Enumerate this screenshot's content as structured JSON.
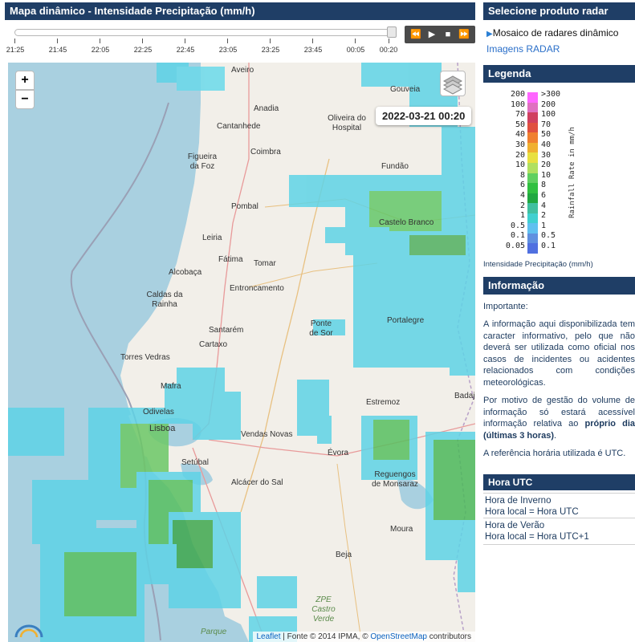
{
  "map_panel": {
    "title": "Mapa dinâmico - Intensidade Precipitação (mm/h)"
  },
  "timeline": {
    "ticks": [
      "21:25",
      "21:45",
      "22:05",
      "22:25",
      "22:45",
      "23:05",
      "23:25",
      "23:45",
      "00:05",
      "00:20"
    ],
    "controls": {
      "rewind": "⏪",
      "play": "▶",
      "stop": "■",
      "forward": "⏩"
    }
  },
  "map": {
    "zoom_in": "+",
    "zoom_out": "−",
    "timestamp": "2022-03-21 00:20",
    "cities": [
      "Aveiro",
      "Gouveia",
      "Anadia",
      "Oliveira do Hospital",
      "Cantanhede",
      "Coimbra",
      "Figueira da Foz",
      "Fundão",
      "Pombal",
      "Castelo Branco",
      "Leiria",
      "Fátima",
      "Tomar",
      "Alcobaça",
      "Caldas da Rainha",
      "Entroncamento",
      "Santarém",
      "Ponte de Sor",
      "Portalegre",
      "Cartaxo",
      "Torres Vedras",
      "Mafra",
      "Odivelas",
      "Lisboa",
      "Setúbal",
      "Vendas Novas",
      "Estremoz",
      "Évora",
      "Reguengos de Monsaraz",
      "Alcácer do Sal",
      "Moura",
      "Beja",
      "ZPE Castro Verde",
      "Badajoz",
      "Parque"
    ],
    "attribution": {
      "leaflet": "Leaflet",
      "fonte": " | Fonte © 2014 IPMA, © ",
      "osm": "OpenStreetMap",
      "contrib": " contributors"
    }
  },
  "radar_product": {
    "title": "Selecione produto radar",
    "options": [
      "Mosaico de radares dinâmico",
      "Imagens RADAR"
    ]
  },
  "legend": {
    "title": "Legenda",
    "left_scale": [
      "200",
      "100",
      "70",
      "50",
      "40",
      "30",
      "20",
      "10",
      "8",
      "6",
      "4",
      "2",
      "1",
      "0.5",
      "0.1",
      "0.05"
    ],
    "right_scale": [
      ">300",
      "200",
      "100",
      "70",
      "50",
      "40",
      "30",
      "20",
      "10",
      "8",
      "6",
      "4",
      "2",
      "1",
      "0.5",
      "0.1"
    ],
    "axis_label": "Rainfall Rate in mm/h",
    "caption": "Intensidade Precipitação  (mm/h)",
    "colors": [
      "#ff66ff",
      "#e070c0",
      "#d04060",
      "#e05040",
      "#f08030",
      "#f0b030",
      "#e8e040",
      "#b0e060",
      "#60d060",
      "#30c040",
      "#20a840",
      "#40c0a0",
      "#40d0d0",
      "#60c0f0",
      "#6090e0",
      "#5070e0"
    ]
  },
  "info": {
    "title": "Informação",
    "important": "Importante:",
    "p1": "A informação aqui disponibilizada tem caracter informativo, pelo que não deverá ser utilizada como oficial nos casos de incidentes ou acidentes relacionados com condições meteorológicas.",
    "p2_pre": "Por motivo de gestão do volume de informação só estará acessível informação relativa ao ",
    "p2_bold": "próprio dia (últimas 3 horas)",
    "p2_post": ".",
    "p3": "A referência horária utilizada é UTC."
  },
  "hora": {
    "title": "Hora UTC",
    "winter_label": "Hora de Inverno",
    "winter_value": "Hora local = Hora UTC",
    "summer_label": "Hora de Verão",
    "summer_value": "Hora local = Hora UTC+1"
  }
}
